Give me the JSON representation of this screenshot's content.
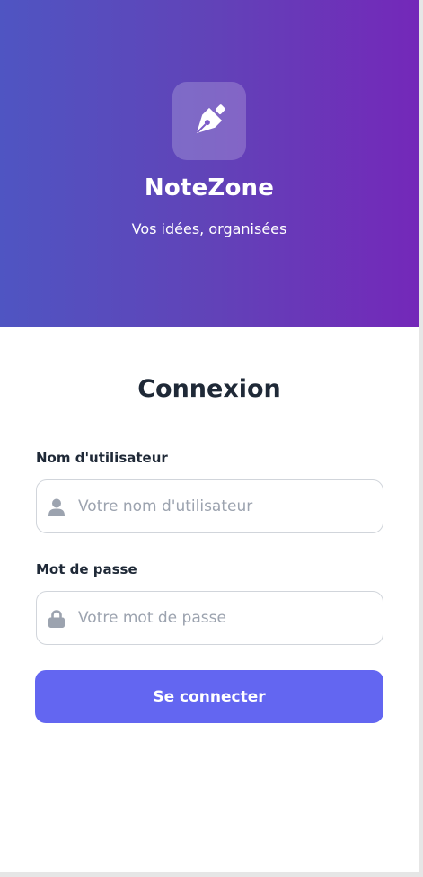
{
  "header": {
    "app_name": "NoteZone",
    "tagline": "Vos idées, organisées",
    "logo_icon": "pen-nib-icon"
  },
  "login": {
    "title": "Connexion",
    "username": {
      "label": "Nom d'utilisateur",
      "placeholder": "Votre nom d'utilisateur",
      "value": "",
      "icon": "user-icon"
    },
    "password": {
      "label": "Mot de passe",
      "placeholder": "Votre mot de passe",
      "value": "",
      "icon": "lock-icon"
    },
    "submit_label": "Se connecter"
  },
  "colors": {
    "gradient_start": "#4f55c2",
    "gradient_end": "#7428b9",
    "primary": "#6366f1",
    "text_dark": "#1f2937",
    "placeholder": "#9ca3af",
    "border": "#d1d5db"
  }
}
